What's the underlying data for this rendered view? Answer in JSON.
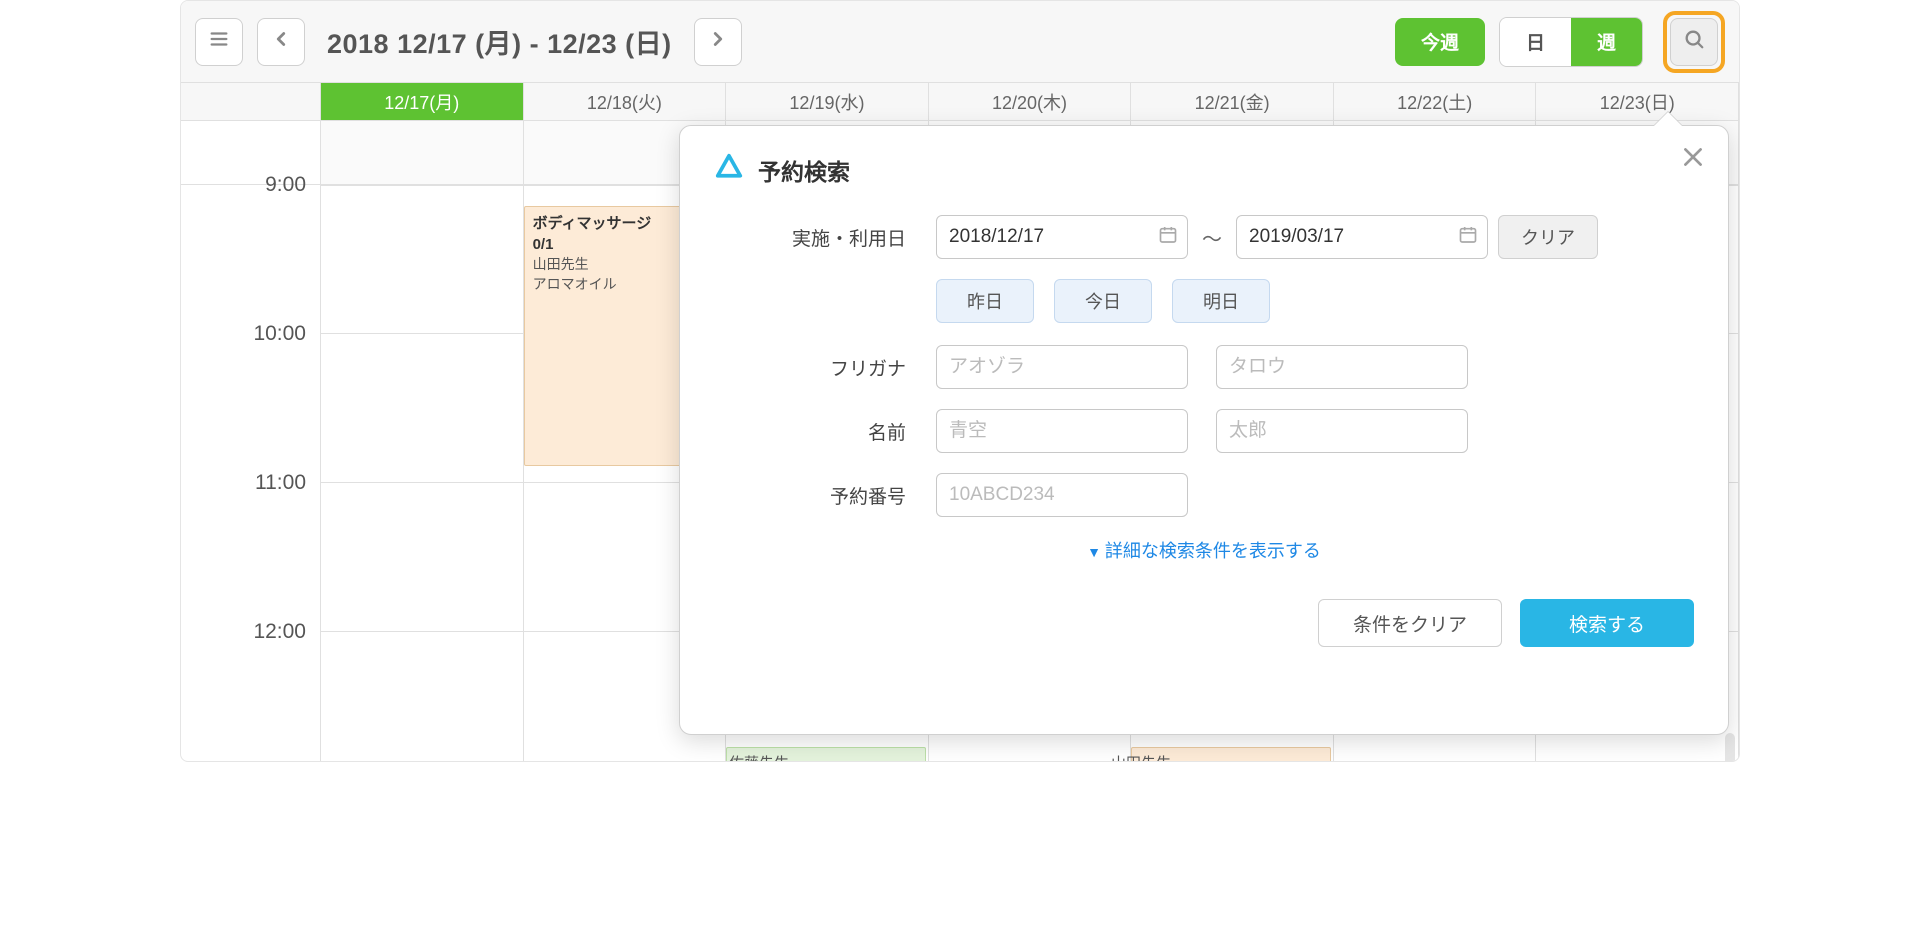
{
  "toolbar": {
    "title_range": "2018 12/17 (月) - 12/23 (日)",
    "this_week": "今週",
    "view_day": "日",
    "view_week": "週"
  },
  "days": [
    {
      "label": "12/17(月)",
      "active": true
    },
    {
      "label": "12/18(火)",
      "active": false
    },
    {
      "label": "12/19(水)",
      "active": false
    },
    {
      "label": "12/20(木)",
      "active": false
    },
    {
      "label": "12/21(金)",
      "active": false
    },
    {
      "label": "12/22(土)",
      "active": false
    },
    {
      "label": "12/23(日)",
      "active": false
    }
  ],
  "time_slots": [
    "9:00",
    "10:00",
    "11:00",
    "12:00"
  ],
  "event": {
    "title": "ボディマッサージ",
    "capacity": "0/1",
    "staff": "山田先生",
    "option": "アロマオイル"
  },
  "bottom_labels": {
    "left": "佐藤先生",
    "right": "山田先生"
  },
  "popup": {
    "title": "予約検索",
    "labels": {
      "date": "実施・利用日",
      "furigana": "フリガナ",
      "name": "名前",
      "booking_no": "予約番号"
    },
    "date_from": "2018/12/17",
    "date_to": "2019/03/17",
    "tilde": "～",
    "clear_date": "クリア",
    "quick": {
      "yesterday": "昨日",
      "today": "今日",
      "tomorrow": "明日"
    },
    "placeholders": {
      "furigana_last": "アオゾラ",
      "furigana_first": "タロウ",
      "name_last": "青空",
      "name_first": "太郎",
      "booking_no": "10ABCD234"
    },
    "advanced_link": "詳細な検索条件を表示する",
    "clear_all": "条件をクリア",
    "submit": "検索する"
  }
}
